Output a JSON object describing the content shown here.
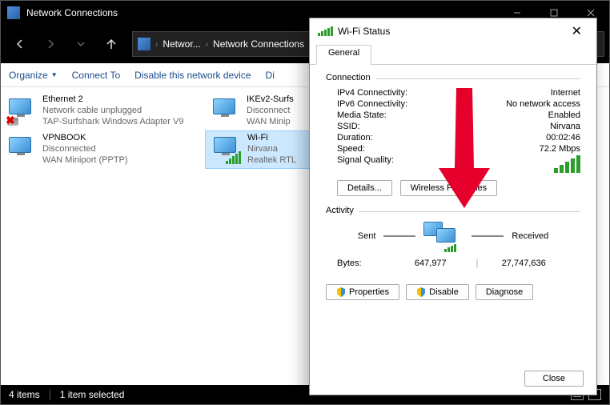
{
  "window": {
    "title": "Network Connections"
  },
  "breadcrumb": {
    "part1": "Networ...",
    "part2": "Network Connections"
  },
  "toolbar": {
    "organize": "Organize",
    "connect_to": "Connect To",
    "disable": "Disable this network device",
    "diagnose": "Di"
  },
  "connections": [
    {
      "name": "Ethernet 2",
      "status": "Network cable unplugged",
      "device": "TAP-Surfshark Windows Adapter V9",
      "icon": "eth",
      "redx": true
    },
    {
      "name": "IKEv2-Surfs",
      "status": "Disconnect",
      "device": "WAN Minip",
      "icon": "vpn"
    },
    {
      "name": "VPNBOOK",
      "status": "Disconnected",
      "device": "WAN Miniport (PPTP)",
      "icon": "vpn"
    },
    {
      "name": "Wi-Fi",
      "status": "Nirvana",
      "device": "Realtek RTL",
      "icon": "wifi",
      "selected": true
    }
  ],
  "statusbar": {
    "items": "4 items",
    "selected": "1 item selected"
  },
  "dialog": {
    "title": "Wi-Fi Status",
    "tab": "General",
    "connection_label": "Connection",
    "rows": {
      "ipv4_k": "IPv4 Connectivity:",
      "ipv4_v": "Internet",
      "ipv6_k": "IPv6 Connectivity:",
      "ipv6_v": "No network access",
      "media_k": "Media State:",
      "media_v": "Enabled",
      "ssid_k": "SSID:",
      "ssid_v": "Nirvana",
      "dur_k": "Duration:",
      "dur_v": "00:02:46",
      "speed_k": "Speed:",
      "speed_v": "72.2 Mbps",
      "sig_k": "Signal Quality:"
    },
    "buttons": {
      "details": "Details...",
      "wireless_props": "Wireless Properties"
    },
    "activity_label": "Activity",
    "sent_label": "Sent",
    "received_label": "Received",
    "bytes_label": "Bytes:",
    "bytes_sent": "647,977",
    "bytes_recv": "27,747,636",
    "btn_properties": "Properties",
    "btn_disable": "Disable",
    "btn_diagnose": "Diagnose",
    "btn_close": "Close"
  }
}
